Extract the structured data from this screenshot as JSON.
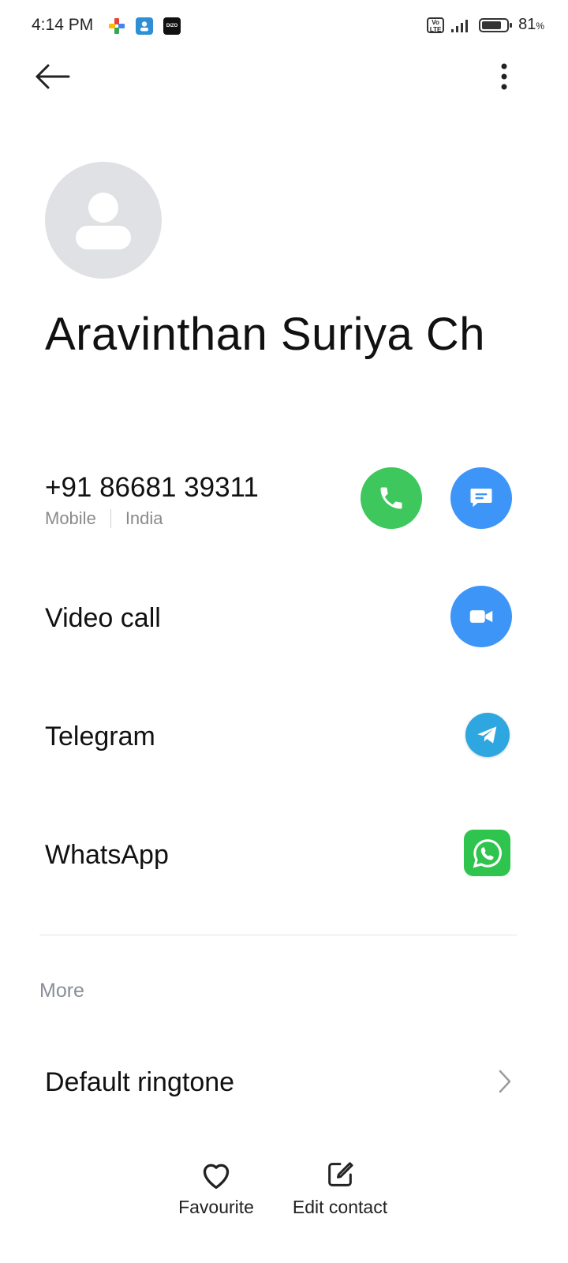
{
  "status_bar": {
    "time": "4:14 PM",
    "network_badge": "Vo LTE",
    "battery": "81",
    "battery_unit": "%",
    "battery_level": 0.81,
    "notification_icons": [
      "photos-icon",
      "contacts-icon",
      "dizo-icon"
    ],
    "dizo_label": "DIZO"
  },
  "header": {
    "back_icon": "arrow-left-icon",
    "more_icon": "more-vertical-icon"
  },
  "contact": {
    "name": "Aravinthan Suriya Ch",
    "phone": {
      "number": "+91 86681 39311",
      "type": "Mobile",
      "country": "India",
      "call_icon": "phone-icon",
      "message_icon": "message-icon"
    },
    "video_call": {
      "label": "Video call",
      "icon": "video-camera-icon"
    },
    "telegram": {
      "label": "Telegram",
      "icon": "telegram-icon"
    },
    "whatsapp": {
      "label": "WhatsApp",
      "icon": "whatsapp-icon"
    }
  },
  "more_section": {
    "title": "More",
    "default_ringtone": "Default ringtone"
  },
  "bottom_bar": {
    "favourite": "Favourite",
    "edit_contact": "Edit contact"
  },
  "colors": {
    "call_green": "#3ec75c",
    "action_blue": "#3d96f7",
    "telegram_blue": "#2ea6df",
    "whatsapp_green": "#2fc44d",
    "avatar_gray": "#dfe1e5"
  }
}
